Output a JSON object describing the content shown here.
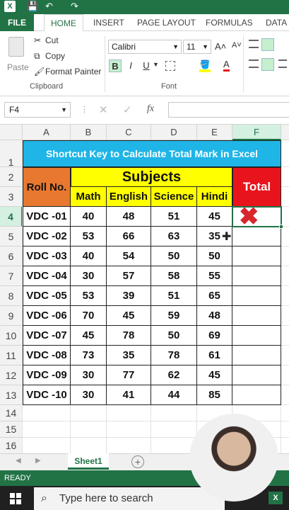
{
  "ribbon": {
    "tabs": [
      "FILE",
      "HOME",
      "INSERT",
      "PAGE LAYOUT",
      "FORMULAS",
      "DATA"
    ],
    "clipboard": {
      "paste": "Paste",
      "cut": "Cut",
      "copy": "Copy",
      "format_painter": "Format Painter",
      "label": "Clipboard"
    },
    "font": {
      "name": "Calibri",
      "size": "11",
      "label": "Font",
      "bold": "B",
      "italic": "I",
      "underline": "U"
    }
  },
  "formula_bar": {
    "name_box": "F4",
    "fx": "fx",
    "cancel": "✕",
    "enter": "✓"
  },
  "columns": [
    "A",
    "B",
    "C",
    "D",
    "E",
    "F"
  ],
  "row_numbers": [
    "1",
    "2",
    "3",
    "4",
    "5",
    "6",
    "7",
    "8",
    "9",
    "10",
    "11",
    "12",
    "13",
    "14",
    "15",
    "16"
  ],
  "sheet": {
    "title": "Shortcut Key to Calculate Total Mark in Excel",
    "roll_header": "Roll No.",
    "subjects_header": "Subjects",
    "subject_names": [
      "Math",
      "English",
      "Science",
      "Hindi"
    ],
    "total_header": "Total",
    "rows": [
      {
        "roll": "VDC -01",
        "marks": [
          "40",
          "48",
          "51",
          "45"
        ]
      },
      {
        "roll": "VDC -02",
        "marks": [
          "53",
          "66",
          "63",
          "35"
        ]
      },
      {
        "roll": "VDC -03",
        "marks": [
          "40",
          "54",
          "50",
          "50"
        ]
      },
      {
        "roll": "VDC -04",
        "marks": [
          "30",
          "57",
          "58",
          "55"
        ]
      },
      {
        "roll": "VDC -05",
        "marks": [
          "53",
          "39",
          "51",
          "65"
        ]
      },
      {
        "roll": "VDC -06",
        "marks": [
          "70",
          "45",
          "59",
          "48"
        ]
      },
      {
        "roll": "VDC -07",
        "marks": [
          "45",
          "78",
          "50",
          "69"
        ]
      },
      {
        "roll": "VDC -08",
        "marks": [
          "73",
          "35",
          "78",
          "61"
        ]
      },
      {
        "roll": "VDC -09",
        "marks": [
          "30",
          "77",
          "62",
          "45"
        ]
      },
      {
        "roll": "VDC -10",
        "marks": [
          "30",
          "41",
          "44",
          "85"
        ]
      }
    ]
  },
  "sheet_tab": "Sheet1",
  "status": "READY",
  "taskbar": {
    "search_placeholder": "Type here to search"
  },
  "colors": {
    "excel_green": "#217346",
    "title_blue": "#1fb5e6",
    "roll_orange": "#e8782f",
    "subjects_yellow": "#ffff00",
    "total_red": "#e8141c"
  }
}
